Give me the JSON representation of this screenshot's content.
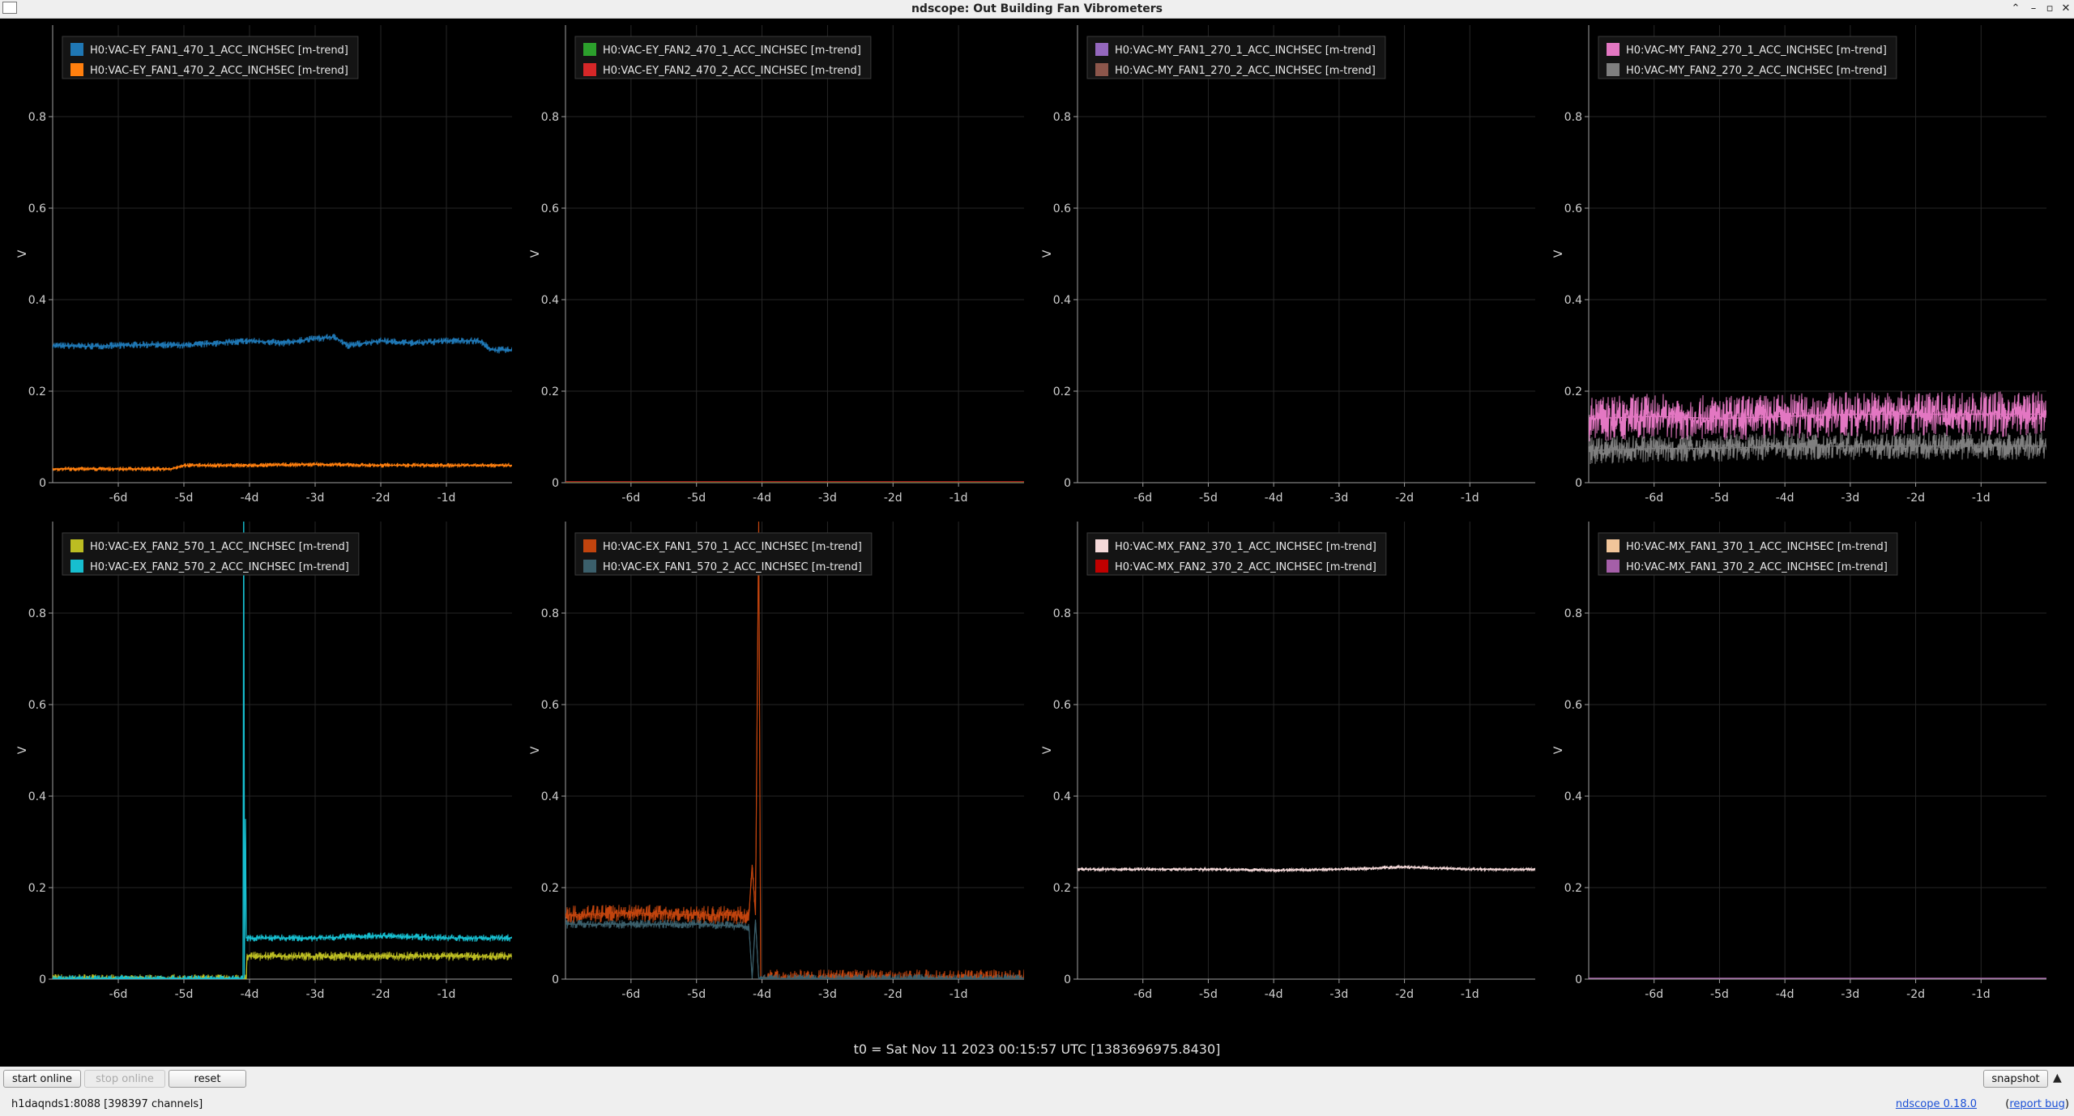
{
  "window": {
    "title": "ndscope: Out Building Fan Vibrometers",
    "icons": {
      "minimize": "minimize-icon",
      "maximize": "maximize-icon",
      "close": "close-icon",
      "restore": "restore-icon"
    }
  },
  "plot_style": {
    "background": "#000000",
    "axis_color": "#a0a0a0",
    "tick_label_color": "#d0d0d0",
    "grid_color": "#262626"
  },
  "chart_data": [
    {
      "type": "line",
      "ylabel": "V",
      "ylim": [
        0,
        1
      ],
      "yticks": [
        0,
        0.2,
        0.4,
        0.6,
        0.8
      ],
      "xlim": [
        -7,
        0
      ],
      "xticks": [
        -6,
        -5,
        -4,
        -3,
        -2,
        -1
      ],
      "xtick_labels": [
        "-6d",
        "-5d",
        "-4d",
        "-3d",
        "-2d",
        "-1d"
      ],
      "legend_position": "top-left",
      "series": [
        {
          "name": "H0:VAC-EY_FAN1_470_1_ACC_INCHSEC [m-trend]",
          "color": "#1f77b4",
          "band": 0.008,
          "x": [
            -7,
            -6.5,
            -6,
            -5.5,
            -5,
            -4.5,
            -4,
            -3.5,
            -3,
            -2.7,
            -2.5,
            -2,
            -1.5,
            -1,
            -0.5,
            -0.3,
            0
          ],
          "y": [
            0.3,
            0.298,
            0.3,
            0.302,
            0.3,
            0.305,
            0.31,
            0.305,
            0.315,
            0.318,
            0.3,
            0.31,
            0.305,
            0.31,
            0.31,
            0.29,
            0.29
          ]
        },
        {
          "name": "H0:VAC-EY_FAN1_470_2_ACC_INCHSEC [m-trend]",
          "color": "#ff7f0e",
          "band": 0.005,
          "x": [
            -7,
            -6,
            -5.2,
            -5,
            -4,
            -3,
            -2,
            -1,
            0
          ],
          "y": [
            0.03,
            0.03,
            0.03,
            0.038,
            0.038,
            0.04,
            0.038,
            0.038,
            0.038
          ]
        }
      ]
    },
    {
      "type": "line",
      "ylabel": "V",
      "ylim": [
        0,
        1
      ],
      "yticks": [
        0,
        0.2,
        0.4,
        0.6,
        0.8
      ],
      "xlim": [
        -7,
        0
      ],
      "xticks": [
        -6,
        -5,
        -4,
        -3,
        -2,
        -1
      ],
      "xtick_labels": [
        "-6d",
        "-5d",
        "-4d",
        "-3d",
        "-2d",
        "-1d"
      ],
      "legend_position": "top-left",
      "series": [
        {
          "name": "H0:VAC-EY_FAN2_470_1_ACC_INCHSEC [m-trend]",
          "color": "#2ca02c",
          "band": 0,
          "x": [
            -7,
            0
          ],
          "y": [
            0.001,
            0.001
          ]
        },
        {
          "name": "H0:VAC-EY_FAN2_470_2_ACC_INCHSEC [m-trend]",
          "color": "#d62728",
          "band": 0,
          "x": [
            -7,
            0
          ],
          "y": [
            0.002,
            0.002
          ]
        }
      ]
    },
    {
      "type": "line",
      "ylabel": "V",
      "ylim": [
        0,
        1
      ],
      "yticks": [
        0,
        0.2,
        0.4,
        0.6,
        0.8
      ],
      "xlim": [
        -7,
        0
      ],
      "xticks": [
        -6,
        -5,
        -4,
        -3,
        -2,
        -1
      ],
      "xtick_labels": [
        "-6d",
        "-5d",
        "-4d",
        "-3d",
        "-2d",
        "-1d"
      ],
      "legend_position": "top-left",
      "series": [
        {
          "name": "H0:VAC-MY_FAN1_270_1_ACC_INCHSEC [m-trend]",
          "color": "#9467bd",
          "band": 0,
          "x": [],
          "y": []
        },
        {
          "name": "H0:VAC-MY_FAN1_270_2_ACC_INCHSEC [m-trend]",
          "color": "#8c564b",
          "band": 0,
          "x": [],
          "y": []
        }
      ]
    },
    {
      "type": "line",
      "ylabel": "V",
      "ylim": [
        0,
        1
      ],
      "yticks": [
        0,
        0.2,
        0.4,
        0.6,
        0.8
      ],
      "xlim": [
        -7,
        0
      ],
      "xticks": [
        -6,
        -5,
        -4,
        -3,
        -2,
        -1
      ],
      "xtick_labels": [
        "-6d",
        "-5d",
        "-4d",
        "-3d",
        "-2d",
        "-1d"
      ],
      "legend_position": "top-left",
      "series": [
        {
          "name": "H0:VAC-MY_FAN2_270_1_ACC_INCHSEC [m-trend]",
          "color": "#e377c2",
          "band": 0.05,
          "x": [
            -7,
            -6,
            -5,
            -4,
            -3,
            -2,
            -1,
            0
          ],
          "y": [
            0.14,
            0.145,
            0.14,
            0.145,
            0.15,
            0.15,
            0.15,
            0.15
          ]
        },
        {
          "name": "H0:VAC-MY_FAN2_270_2_ACC_INCHSEC [m-trend]",
          "color": "#7f7f7f",
          "band": 0.03,
          "x": [
            -7,
            -6,
            -5,
            -4,
            -3,
            -2,
            -1,
            0
          ],
          "y": [
            0.07,
            0.075,
            0.075,
            0.08,
            0.08,
            0.08,
            0.08,
            0.08
          ]
        }
      ]
    },
    {
      "type": "line",
      "ylabel": "V",
      "ylim": [
        0,
        1
      ],
      "yticks": [
        0,
        0.2,
        0.4,
        0.6,
        0.8
      ],
      "xlim": [
        -7,
        0
      ],
      "xticks": [
        -6,
        -5,
        -4,
        -3,
        -2,
        -1
      ],
      "xtick_labels": [
        "-6d",
        "-5d",
        "-4d",
        "-3d",
        "-2d",
        "-1d"
      ],
      "legend_position": "top-left",
      "series": [
        {
          "name": "H0:VAC-EX_FAN2_570_1_ACC_INCHSEC [m-trend]",
          "color": "#bcbd22",
          "band": 0.01,
          "x": [
            -7,
            -4.05,
            -4.04,
            -3,
            -2,
            -1,
            0
          ],
          "y": [
            0.001,
            0.001,
            0.05,
            0.05,
            0.05,
            0.05,
            0.05
          ]
        },
        {
          "name": "H0:VAC-EX_FAN2_570_2_ACC_INCHSEC [m-trend]",
          "color": "#17becf",
          "band": 0.008,
          "x": [
            -7,
            -4.1,
            -4.09,
            -4.08,
            -4.06,
            -4.05,
            -4.04,
            -3,
            -2,
            -1,
            0
          ],
          "y": [
            0.001,
            0.001,
            1.0,
            0.001,
            0.35,
            0.09,
            0.09,
            0.09,
            0.095,
            0.09,
            0.09
          ]
        }
      ]
    },
    {
      "type": "line",
      "ylabel": "V",
      "ylim": [
        0,
        1
      ],
      "yticks": [
        0,
        0.2,
        0.4,
        0.6,
        0.8
      ],
      "xlim": [
        -7,
        0
      ],
      "xticks": [
        -6,
        -5,
        -4,
        -3,
        -2,
        -1
      ],
      "xtick_labels": [
        "-6d",
        "-5d",
        "-4d",
        "-3d",
        "-2d",
        "-1d"
      ],
      "legend_position": "top-left",
      "series": [
        {
          "name": "H0:VAC-EX_FAN1_570_1_ACC_INCHSEC [m-trend]",
          "color": "#c1440e",
          "band": 0.02,
          "x": [
            -7,
            -6,
            -5,
            -4.2,
            -4.15,
            -4.1,
            -4.05,
            -4.02,
            -4.0,
            0
          ],
          "y": [
            0.14,
            0.145,
            0.14,
            0.14,
            0.25,
            0.14,
            1.0,
            0.001,
            0.001,
            0.001
          ]
        },
        {
          "name": "H0:VAC-EX_FAN1_570_2_ACC_INCHSEC [m-trend]",
          "color": "#3b5f6b",
          "band": 0.01,
          "x": [
            -7,
            -6,
            -5,
            -4.2,
            -4.15,
            -4.1,
            -4.05,
            -4.02,
            -4.0,
            0
          ],
          "y": [
            0.12,
            0.12,
            0.12,
            0.115,
            0.001,
            0.13,
            0.001,
            0.001,
            0.001,
            0.001
          ]
        }
      ]
    },
    {
      "type": "line",
      "ylabel": "V",
      "ylim": [
        0,
        1
      ],
      "yticks": [
        0,
        0.2,
        0.4,
        0.6,
        0.8
      ],
      "xlim": [
        -7,
        0
      ],
      "xticks": [
        -6,
        -5,
        -4,
        -3,
        -2,
        -1
      ],
      "xtick_labels": [
        "-6d",
        "-5d",
        "-4d",
        "-3d",
        "-2d",
        "-1d"
      ],
      "legend_position": "top-left",
      "series": [
        {
          "name": "H0:VAC-MX_FAN2_370_1_ACC_INCHSEC [m-trend]",
          "color": "#f5d9d9",
          "band": 0.004,
          "x": [
            -7,
            -6,
            -5,
            -4,
            -3,
            -2,
            -1,
            0
          ],
          "y": [
            0.24,
            0.24,
            0.24,
            0.238,
            0.24,
            0.245,
            0.24,
            0.24
          ]
        },
        {
          "name": "H0:VAC-MX_FAN2_370_2_ACC_INCHSEC [m-trend]",
          "color": "#c00000",
          "band": 0,
          "x": [],
          "y": []
        }
      ]
    },
    {
      "type": "line",
      "ylabel": "V",
      "ylim": [
        0,
        1
      ],
      "yticks": [
        0,
        0.2,
        0.4,
        0.6,
        0.8
      ],
      "xlim": [
        -7,
        0
      ],
      "xticks": [
        -6,
        -5,
        -4,
        -3,
        -2,
        -1
      ],
      "xtick_labels": [
        "-6d",
        "-5d",
        "-4d",
        "-3d",
        "-2d",
        "-1d"
      ],
      "legend_position": "top-left",
      "series": [
        {
          "name": "H0:VAC-MX_FAN1_370_1_ACC_INCHSEC [m-trend]",
          "color": "#f1c59a",
          "band": 0,
          "x": [],
          "y": []
        },
        {
          "name": "H0:VAC-MX_FAN1_370_2_ACC_INCHSEC [m-trend]",
          "color": "#a55fa8",
          "band": 0,
          "x": [
            -7,
            0
          ],
          "y": [
            0.002,
            0.002
          ]
        }
      ]
    }
  ],
  "t0_label": "t0 = Sat Nov 11 2023 00:15:57 UTC [1383696975.8430]",
  "controls": {
    "start_online": "start online",
    "stop_online": "stop online",
    "reset": "reset",
    "snapshot": "snapshot",
    "menu_icon": "triangle-up-icon"
  },
  "status": {
    "server": "h1daqnds1:8088  [398397 channels]",
    "version": "ndscope 0.18.0",
    "report_open": "(",
    "report_bug": "report bug",
    "report_close": ")"
  }
}
